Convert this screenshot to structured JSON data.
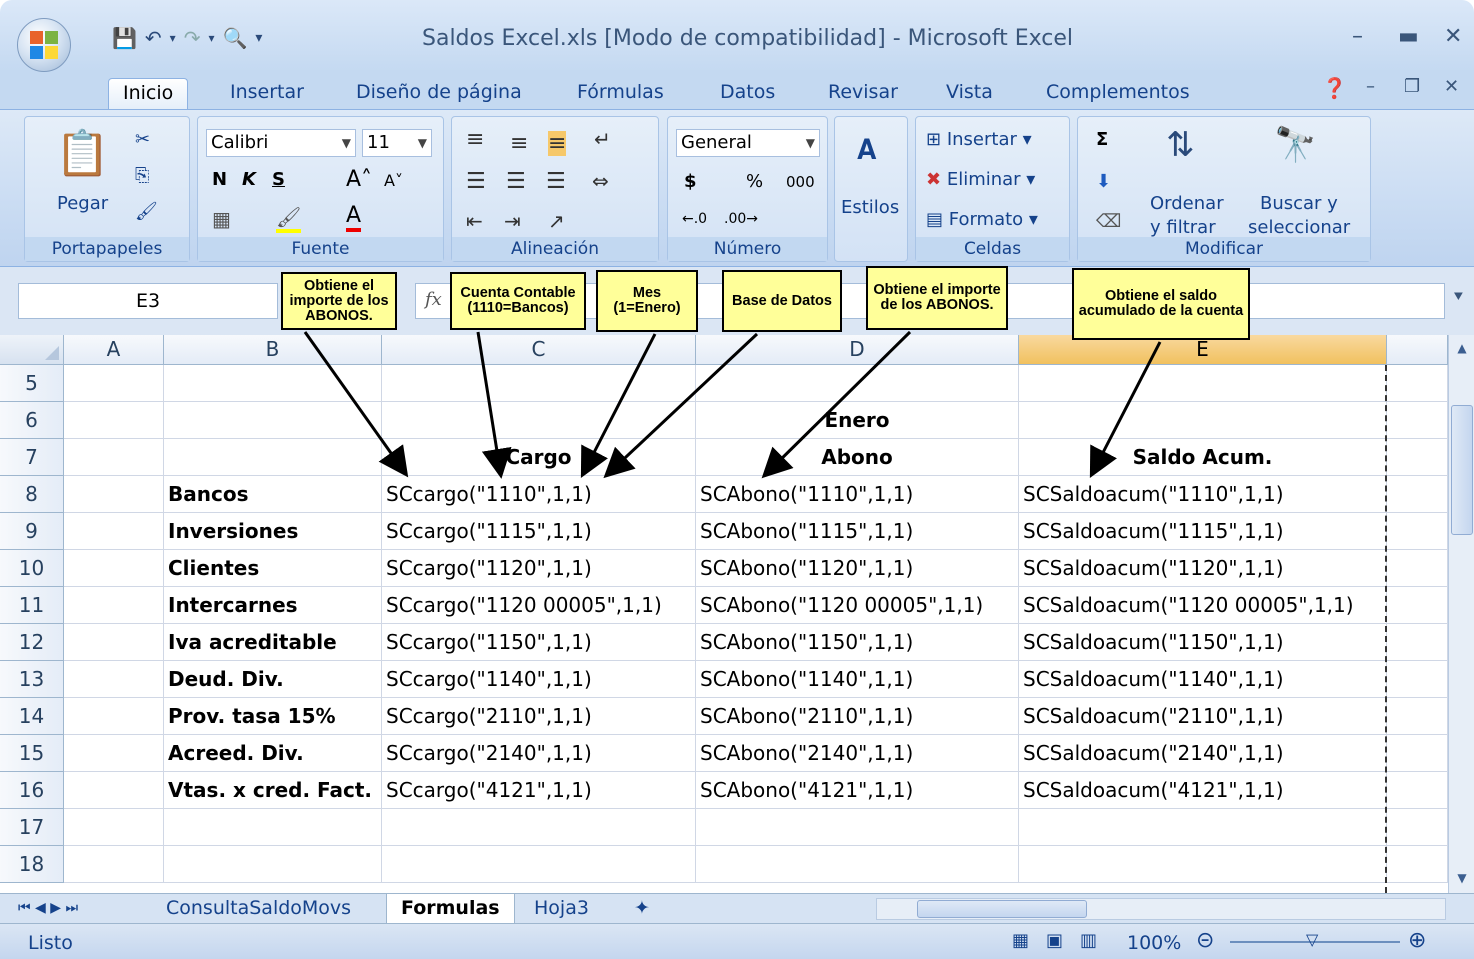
{
  "window": {
    "title": "Saldos Excel.xls  [Modo de compatibilidad] - Microsoft Excel"
  },
  "ribbon_tabs": [
    "Inicio",
    "Insertar",
    "Diseño de página",
    "Fórmulas",
    "Datos",
    "Revisar",
    "Vista",
    "Complementos"
  ],
  "active_tab": "Inicio",
  "ribbon": {
    "clipboard": {
      "paste_label": "Pegar",
      "group_label": "Portapapeles"
    },
    "font": {
      "font_name": "Calibri",
      "font_size": "11",
      "bold": "N",
      "italic": "K",
      "underline": "S",
      "group_label": "Fuente"
    },
    "alignment": {
      "group_label": "Alineación"
    },
    "number": {
      "format": "General",
      "currency": "$",
      "percent": "%",
      "thousands": "000",
      "group_label": "Número"
    },
    "styles": {
      "label": "Estilos"
    },
    "cells": {
      "insert": "Insertar",
      "delete": "Eliminar",
      "format": "Formato",
      "group_label": "Celdas"
    },
    "editing": {
      "sort_line1": "Ordenar",
      "sort_line2": "y filtrar",
      "find_line1": "Buscar y",
      "find_line2": "seleccionar",
      "sigma": "Σ",
      "group_label": "Modificar"
    }
  },
  "formula_bar": {
    "name_box": "E3",
    "fx": "fx",
    "formula": ""
  },
  "columns": [
    "A",
    "B",
    "C",
    "D",
    "E"
  ],
  "selected_column": "E",
  "rows": [
    {
      "n": "5",
      "b": "",
      "c": "",
      "d": "",
      "e": ""
    },
    {
      "n": "6",
      "b": "",
      "c": "",
      "d": "Enero",
      "e": ""
    },
    {
      "n": "7",
      "b": "",
      "c": "Cargo",
      "d": "Abono",
      "e": "Saldo Acum."
    },
    {
      "n": "8",
      "b": "Bancos",
      "c": "SCcargo(\"1110\",1,1)",
      "d": "SCAbono(\"1110\",1,1)",
      "e": "SCSaldoacum(\"1110\",1,1)"
    },
    {
      "n": "9",
      "b": "Inversiones",
      "c": "SCcargo(\"1115\",1,1)",
      "d": "SCAbono(\"1115\",1,1)",
      "e": "SCSaldoacum(\"1115\",1,1)"
    },
    {
      "n": "10",
      "b": "Clientes",
      "c": "SCcargo(\"1120\",1,1)",
      "d": "SCAbono(\"1120\",1,1)",
      "e": "SCSaldoacum(\"1120\",1,1)"
    },
    {
      "n": "11",
      "b": "Intercarnes",
      "c": "SCcargo(\"1120  00005\",1,1)",
      "d": "SCAbono(\"1120 00005\",1,1)",
      "e": "SCSaldoacum(\"1120 00005\",1,1)"
    },
    {
      "n": "12",
      "b": "Iva acreditable",
      "c": "SCcargo(\"1150\",1,1)",
      "d": "SCAbono(\"1150\",1,1)",
      "e": "SCSaldoacum(\"1150\",1,1)"
    },
    {
      "n": "13",
      "b": "Deud. Div.",
      "c": "SCcargo(\"1140\",1,1)",
      "d": "SCAbono(\"1140\",1,1)",
      "e": "SCSaldoacum(\"1140\",1,1)"
    },
    {
      "n": "14",
      "b": "Prov. tasa 15%",
      "c": "SCcargo(\"2110\",1,1)",
      "d": "SCAbono(\"2110\",1,1)",
      "e": "SCSaldoacum(\"2110\",1,1)"
    },
    {
      "n": "15",
      "b": "Acreed. Div.",
      "c": "SCcargo(\"2140\",1,1)",
      "d": "SCAbono(\"2140\",1,1)",
      "e": "SCSaldoacum(\"2140\",1,1)"
    },
    {
      "n": "16",
      "b": "Vtas. x cred. Fact.",
      "c": "SCcargo(\"4121\",1,1)",
      "d": "SCAbono(\"4121\",1,1)",
      "e": "SCSaldoacum(\"4121\",1,1)"
    },
    {
      "n": "17",
      "b": "",
      "c": "",
      "d": "",
      "e": ""
    },
    {
      "n": "18",
      "b": "",
      "c": "",
      "d": "",
      "e": ""
    }
  ],
  "callouts": [
    {
      "text": "Obtiene el importe de los ABONOS."
    },
    {
      "text": "Cuenta Contable (1110=Bancos)"
    },
    {
      "text": "Mes (1=Enero)"
    },
    {
      "text": "Base de Datos"
    },
    {
      "text": "Obtiene el importe de los ABONOS."
    },
    {
      "text": "Obtiene el saldo acumulado de la cuenta"
    }
  ],
  "sheet_tabs": [
    "ConsultaSaldoMovs",
    "Formulas",
    "Hoja3"
  ],
  "active_sheet": "Formulas",
  "status": {
    "text": "Listo",
    "zoom": "100%"
  },
  "colors": {
    "ribbon": "#c4d9f1",
    "callout": "#ffff99",
    "selected_header": "#f1c15f"
  }
}
